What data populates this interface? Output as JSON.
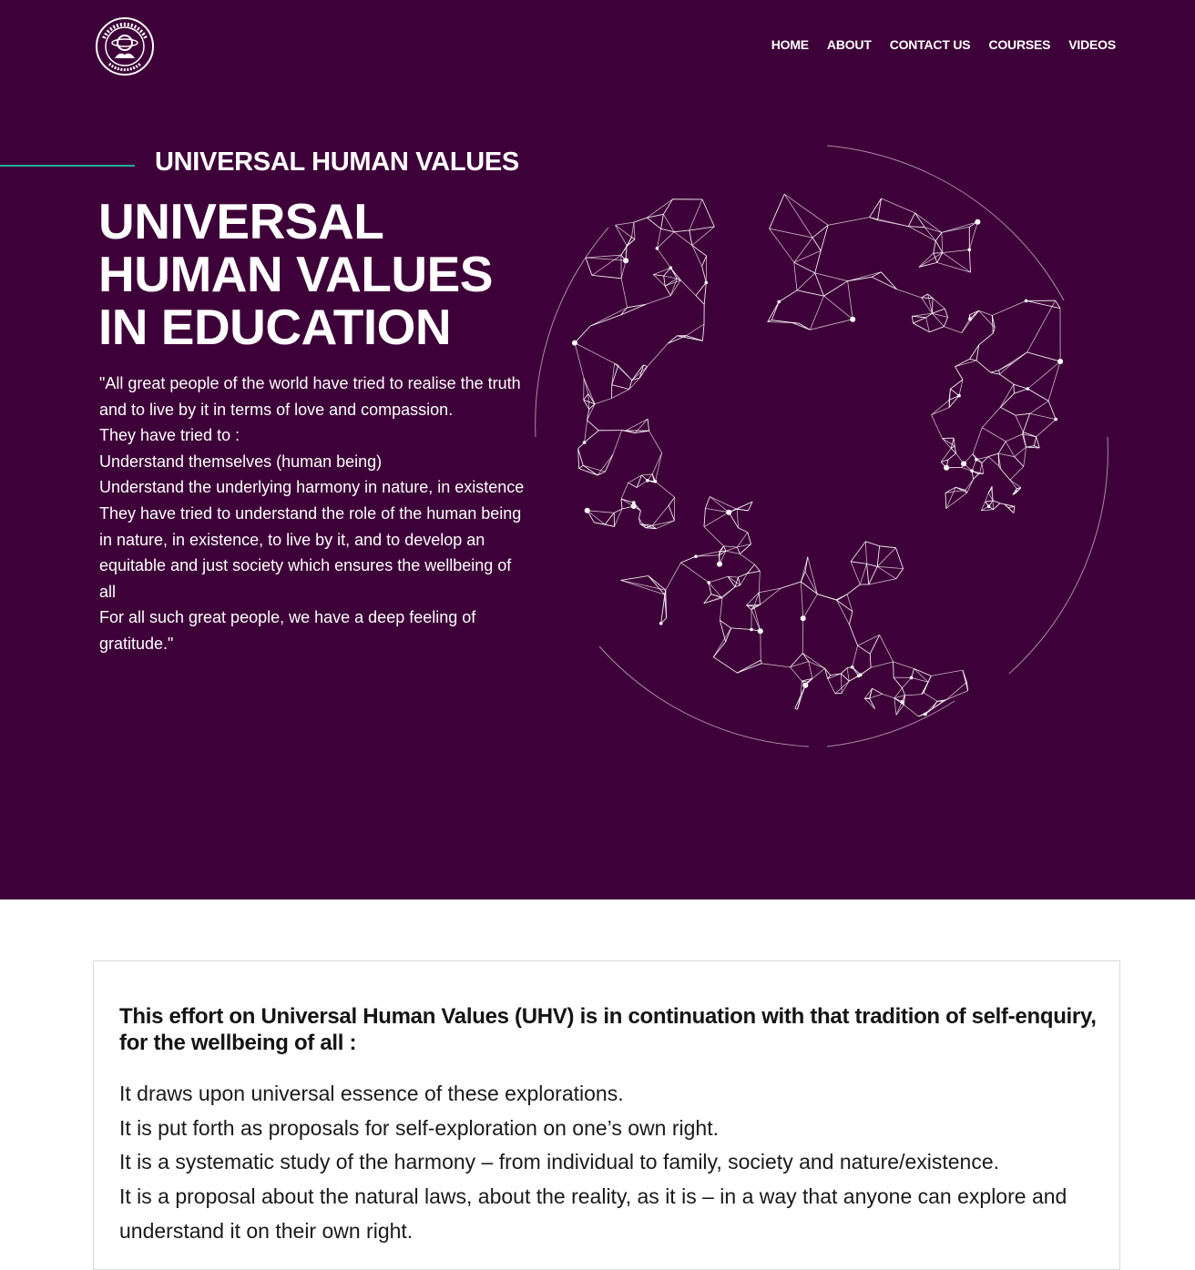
{
  "nav": {
    "logo_alt": "Universal Human Values",
    "items": [
      "HOME",
      "ABOUT",
      "CONTACT US",
      "COURSES",
      "VIDEOS"
    ]
  },
  "hero": {
    "eyebrow": "UNIVERSAL HUMAN VALUES",
    "title_lines": [
      "UNIVERSAL",
      "HUMAN VALUES",
      "IN EDUCATION"
    ],
    "quote_lines": [
      "\"All great people of the world have tried to realise the truth and to live by it in terms of love and compassion.",
      "They have tried to :",
      "Understand themselves (human being)",
      "Understand the underlying harmony in nature, in existence",
      "They have tried to understand the role of the human being in nature, in existence, to live by it, and to develop an equitable and just society which ensures the wellbeing of all",
      "For all such great people, we have a deep feeling of gratitude.\""
    ]
  },
  "section": {
    "heading": "This effort on Universal Human Values (UHV) is in continuation with that tradition of self-enquiry, for the wellbeing of all :",
    "points": [
      "It draws upon universal essence of these explorations.",
      "It is put forth as proposals for self-exploration on one’s own right.",
      "It is a systematic study of the harmony – from individual to family, society and nature/existence.",
      "It is a proposal about the natural laws, about the reality, as it is – in a way that anyone can explore and understand it on their own right."
    ]
  },
  "colors": {
    "hero_bg": "#3e0038",
    "accent": "#1fae9a",
    "text_light": "#ffffff",
    "text_dark": "#141414"
  }
}
